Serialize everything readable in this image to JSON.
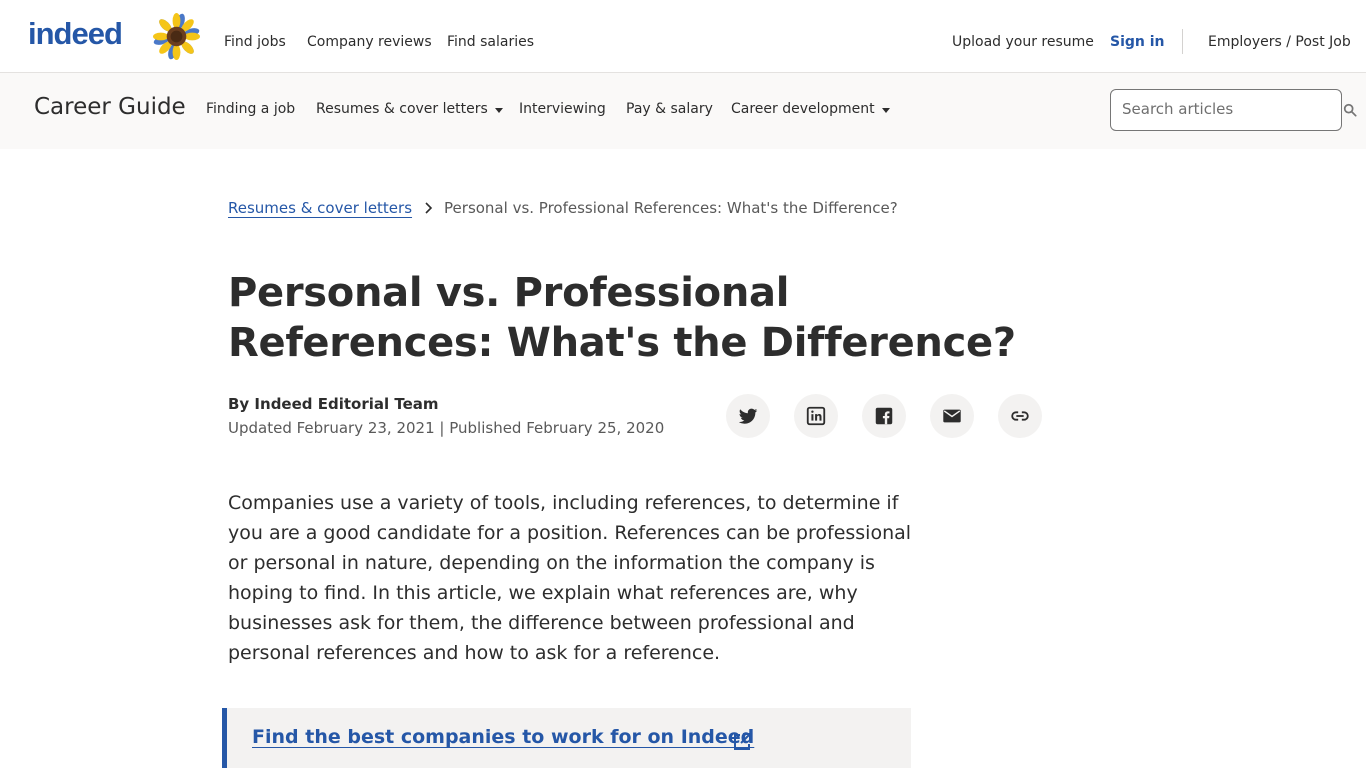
{
  "topnav": {
    "logo": "indeed",
    "links": {
      "find_jobs": "Find jobs",
      "company_reviews": "Company reviews",
      "find_salaries": "Find salaries",
      "upload_resume": "Upload your resume",
      "sign_in": "Sign in",
      "employers": "Employers / Post Job"
    }
  },
  "career_guide": {
    "title": "Career Guide",
    "nav": {
      "finding_job": "Finding a job",
      "resumes": "Resumes & cover letters",
      "interviewing": "Interviewing",
      "pay": "Pay & salary",
      "career_dev": "Career development"
    },
    "search_placeholder": "Search articles"
  },
  "breadcrumb": {
    "parent": "Resumes & cover letters",
    "current": "Personal vs. Professional References: What's the Difference?"
  },
  "article": {
    "title": "Personal vs. Professional References: What's the Difference?",
    "author": "By Indeed Editorial Team",
    "dates": "Updated February 23, 2021 | Published February 25, 2020",
    "intro": "Companies use a variety of tools, including references, to determine if you are a good candidate for a position. References can be professional or personal in nature, depending on the information the company is hoping to find. In this article, we explain what references are, why businesses ask for them, the difference between professional and personal references and how to ask for a reference.",
    "callout": "Find the best companies to work for on Indeed"
  },
  "share_icons": [
    "twitter-icon",
    "linkedin-icon",
    "facebook-icon",
    "email-icon",
    "link-icon"
  ],
  "colors": {
    "brand_blue": "#2557a7",
    "text": "#2d2d2d",
    "muted": "#595959",
    "bar_bg": "#faf9f8",
    "share_bg": "#f3f2f1"
  }
}
